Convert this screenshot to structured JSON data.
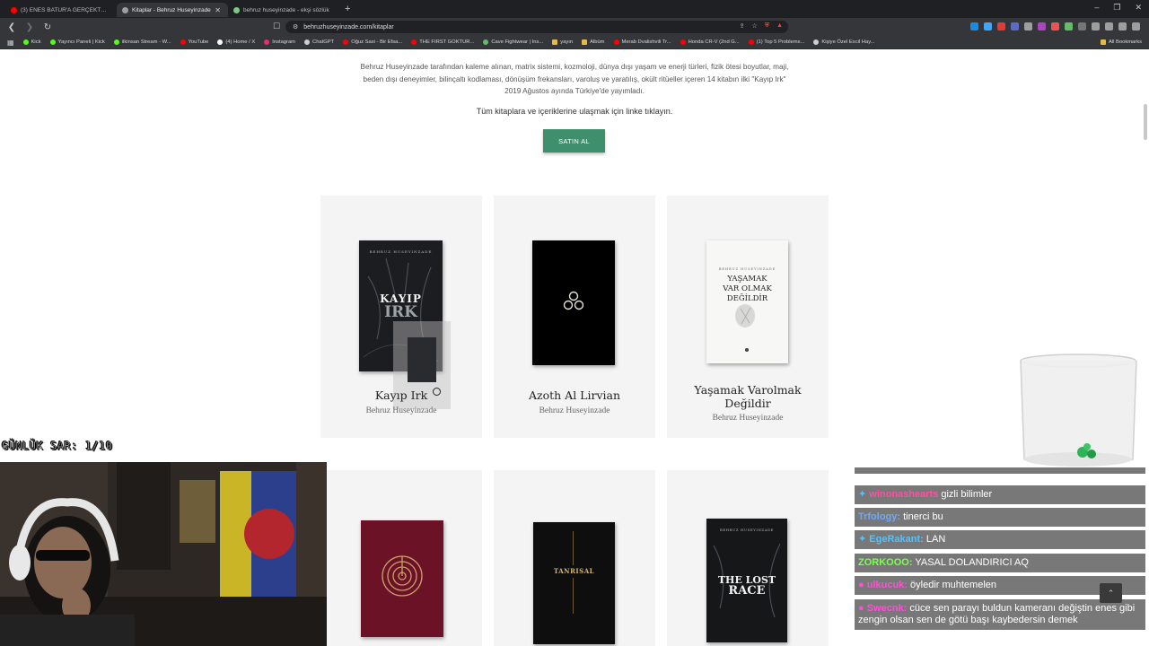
{
  "browser": {
    "tabs": [
      {
        "label": "(3) ENES BATUR'A GERÇEKTEN NE OLDU?",
        "active": false,
        "favicon_color": "#ff0000"
      },
      {
        "label": "Kitaplar - Behruz Huseyinzade",
        "active": true,
        "favicon_color": "#9aa0a6"
      },
      {
        "label": "behruz huseyinzade - ekşi sözlük",
        "active": false,
        "favicon_color": "#81c784"
      }
    ],
    "new_tab": "+",
    "url": "behruzhuseyinzade.com/kitaplar",
    "bookmarks": [
      {
        "label": "Kick",
        "color": "#53fc18"
      },
      {
        "label": "Yayıncı Paneli | Kick",
        "color": "#53fc18"
      },
      {
        "label": "ilkinsan Stream - W...",
        "color": "#53fc18"
      },
      {
        "label": "YouTube",
        "color": "#ff0000"
      },
      {
        "label": "(4) Home / X",
        "color": "#ffffff"
      },
      {
        "label": "Instagram",
        "color": "#e1306c"
      },
      {
        "label": "ChatGPT",
        "color": "#cfcfcf"
      },
      {
        "label": "Oğuz Sasi - Bir Efsa...",
        "color": "#ff0000"
      },
      {
        "label": "THE FIRST GOKTUR...",
        "color": "#ff0000"
      },
      {
        "label": "Cave Fightwear | Ins...",
        "color": "#66bb6a"
      },
      {
        "label": "yayın",
        "color": "#e8b84a"
      },
      {
        "label": "Albüm",
        "color": "#e8b84a"
      },
      {
        "label": "Merab Dvalishvili Tr...",
        "color": "#ff0000"
      },
      {
        "label": "Honda CR-V (2nd G...",
        "color": "#ff0000"
      },
      {
        "label": "(1) Top 5 Problems...",
        "color": "#ff0000"
      },
      {
        "label": "Kişiye Özel Excil Hay...",
        "color": "#cfcfcf"
      }
    ],
    "all_bookmarks": "All Bookmarks"
  },
  "page": {
    "intro_text": "Behruz Huseyinzade tarafından kaleme alınan, matrix sistemi, kozmoloji, dünya dışı yaşam ve enerji türleri, fizik ötesi boyutlar, maji, beden dışı deneyimler, bilinçaltı kodlaması, dönüşüm frekansları, varoluş ve yaratılış, okült ritüeller içeren 14 kitabın ilki \"Kayıp Irk\" 2019 Ağustos ayında Türkiye'de yayımladı.",
    "cta_text": "Tüm kitaplara ve içeriklerine ulaşmak için linke tıklayın.",
    "buy_button": "SATIN AL",
    "books": [
      {
        "title": "Kayıp Irk",
        "author": "Behruz Huseyinzade",
        "cover_author": "BEHRUZ HUSEYINZADE",
        "cover_title_1": "KAYIP",
        "cover_title_2": "IRK"
      },
      {
        "title": "Azoth Al Lirvian",
        "author": "Behruz Huseyinzade"
      },
      {
        "title": "Yaşamak Varolmak Değildir",
        "author": "Behruz Huseyinzade",
        "cover_author": "BEHRUZ HUSEYINZADE",
        "cover_title_1": "YAŞAMAK",
        "cover_title_2": "VAR OLMAK",
        "cover_title_3": "DEĞİLDİR"
      },
      {
        "title": "",
        "author": ""
      },
      {
        "title": "",
        "author": "",
        "cover_title": "TANRISAL"
      },
      {
        "title": "",
        "author": "",
        "cover_author": "BEHRUZ HUSEYINZADE",
        "cover_title_1": "THE LOST",
        "cover_title_2": "RACE"
      }
    ]
  },
  "stream": {
    "counter": "GÜNLÜK SAR: 1/10",
    "chat": [
      {
        "user": "winonashearts",
        "message": "gizli bilimler",
        "user_color": "#ff4fa3"
      },
      {
        "user": "Trfology:",
        "message": "tinerci bu",
        "user_color": "#6fa8ff"
      },
      {
        "user": "EgeRakant:",
        "message": "LAN",
        "user_color": "#4fc3ff"
      },
      {
        "user": "ZORKOOO:",
        "message": "YASAL DOLANDIRICI AQ",
        "user_color": "#7dff4f"
      },
      {
        "user": "ulkucuk:",
        "message": "öyledir muhtemelen",
        "user_color": "#ff4fd8"
      },
      {
        "user": "Swecnk:",
        "message": "cüce sen parayı buldun kameranı değiştin enes gibi zengin olsan sen de götü başı kaybedersin demek",
        "user_color": "#ff4fd8"
      }
    ]
  }
}
